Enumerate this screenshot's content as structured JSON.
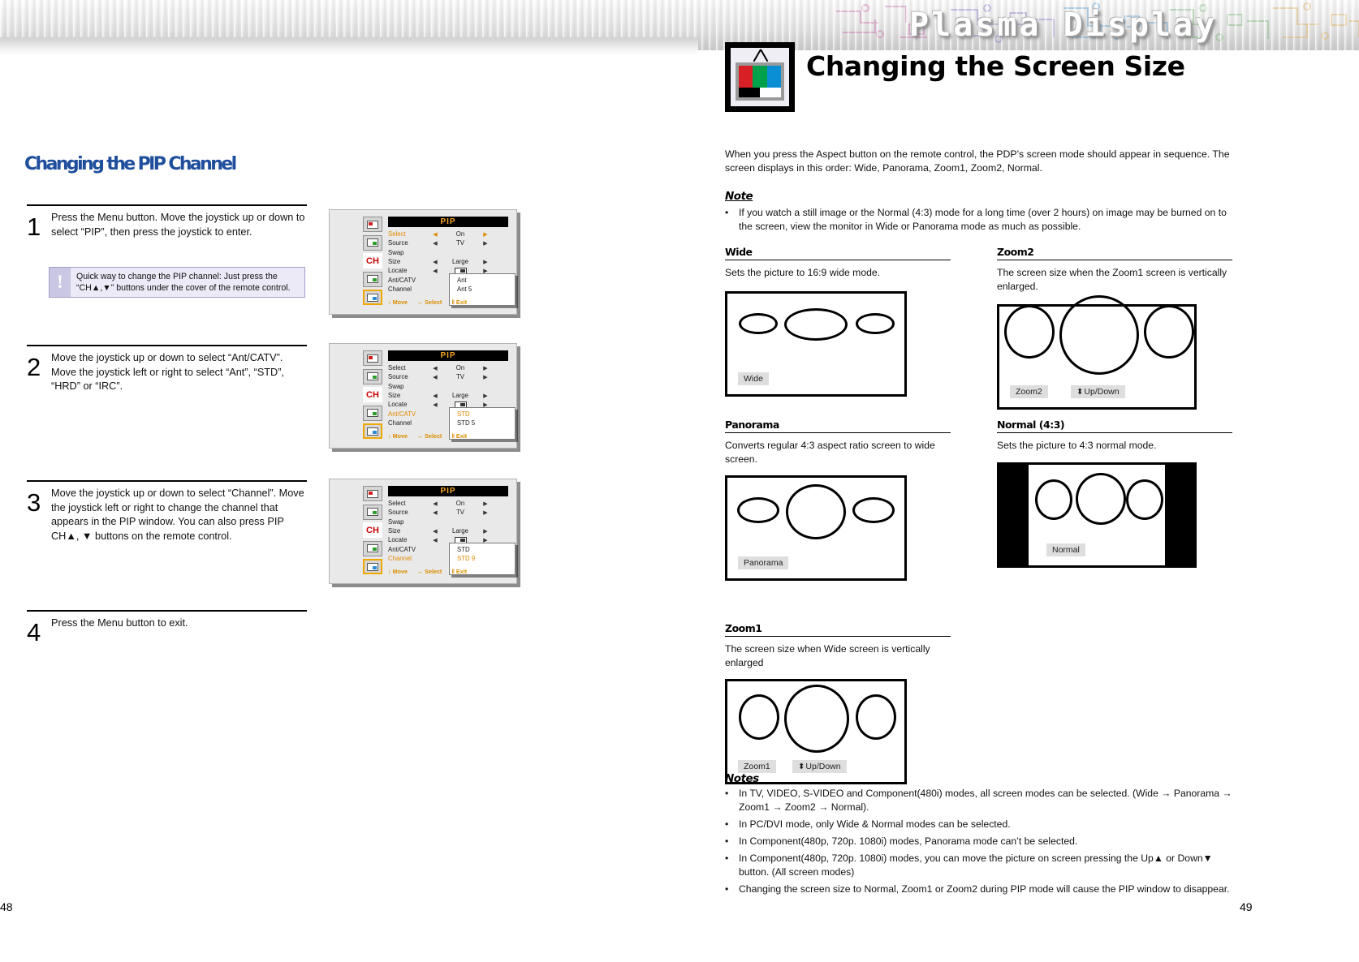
{
  "header": {
    "brand": "Plasma Display",
    "title": "Changing the Screen Size",
    "tv_icon": "tv-icon"
  },
  "left_page": {
    "heading": "Changing the PIP Channel",
    "page_number": "48",
    "steps": [
      {
        "num": "1",
        "text": "Press the Menu button. Move the joystick up or down to select “PIP”, then press the joystick to enter."
      },
      {
        "num": "2",
        "text": "Move the joystick up or down to select “Ant/CATV”. Move the joystick left or right to select “Ant”, “STD”, “HRD” or “IRC”."
      },
      {
        "num": "3",
        "text": "Move the joystick up or down to select “Channel”. Move the joystick left or right to change the channel that appears in the PIP window. You can also press PIP CH▲, ▼ buttons on the remote control."
      },
      {
        "num": "4",
        "text": "Press the Menu button to exit."
      }
    ],
    "tip": {
      "icon": "exclamation-icon",
      "line1": "Quick way to change the PIP channel: Just press the",
      "line2": "“CH▲,▼” buttons under the cover of the remote control."
    },
    "osd_menus": [
      {
        "title": "PIP",
        "highlight": "Select",
        "rows": [
          {
            "label": "Select",
            "value": "On",
            "arrows": true
          },
          {
            "label": "Source",
            "value": "TV",
            "arrows": true
          },
          {
            "label": "Swap",
            "value": "",
            "arrows": false
          },
          {
            "label": "Size",
            "value": "Large",
            "arrows": true
          },
          {
            "label": "Locate",
            "value": "□",
            "arrows": true,
            "isbox": true
          },
          {
            "label": "Ant/CATV",
            "value": "",
            "arrows": false
          },
          {
            "label": "Channel",
            "value": "",
            "arrows": false
          }
        ],
        "popup": {
          "line1": "Ant",
          "line2": "Ant  5",
          "highlight_line": 0
        },
        "bottom": [
          "↕ Move",
          "↔ Select",
          "‖ Exit"
        ]
      },
      {
        "title": "PIP",
        "highlight": "Ant/CATV",
        "rows": [
          {
            "label": "Select",
            "value": "On",
            "arrows": true
          },
          {
            "label": "Source",
            "value": "TV",
            "arrows": true
          },
          {
            "label": "Swap",
            "value": "",
            "arrows": false
          },
          {
            "label": "Size",
            "value": "Large",
            "arrows": true
          },
          {
            "label": "Locate",
            "value": "□",
            "arrows": true,
            "isbox": true
          },
          {
            "label": "Ant/CATV",
            "value": "",
            "arrows": false
          },
          {
            "label": "Channel",
            "value": "",
            "arrows": false
          }
        ],
        "popup": {
          "line1": "STD",
          "line2": "STD  5",
          "highlight_line": 0
        },
        "bottom": [
          "↕ Move",
          "↔ Select",
          "‖ Exit"
        ]
      },
      {
        "title": "PIP",
        "highlight": "Channel",
        "rows": [
          {
            "label": "Select",
            "value": "On",
            "arrows": true
          },
          {
            "label": "Source",
            "value": "TV",
            "arrows": true
          },
          {
            "label": "Swap",
            "value": "",
            "arrows": false
          },
          {
            "label": "Size",
            "value": "Large",
            "arrows": true
          },
          {
            "label": "Locate",
            "value": "□",
            "arrows": true,
            "isbox": true
          },
          {
            "label": "Ant/CATV",
            "value": "",
            "arrows": false
          },
          {
            "label": "Channel",
            "value": "",
            "arrows": false
          }
        ],
        "popup": {
          "line1": "STD",
          "line2": "STD  9",
          "highlight_line": 1
        },
        "bottom": [
          "↕ Move",
          "↔ Select",
          "‖ Exit"
        ]
      }
    ],
    "osd_sidebar_icons": [
      "picture-icon",
      "sound-icon",
      "channel-icon",
      "setup-icon",
      "pip-icon"
    ],
    "osd_ch_label": "CH"
  },
  "right_page": {
    "page_number": "49",
    "intro": "When you press the Aspect button on the remote control, the PDP’s screen mode should appear in sequence. The screen displays in this order: Wide, Panorama, Zoom1, Zoom2, Normal.",
    "note_heading": "Note",
    "note_bullets": [
      "If you watch a still image or the Normal (4:3) mode for a long time (over 2 hours) on image may be burned on to the screen, view the monitor in Wide or Panorama mode as much as possible."
    ],
    "sections": [
      {
        "id": "wide",
        "heading": "Wide",
        "desc": "Sets the picture to 16:9 wide mode.",
        "tags": [
          "Wide"
        ],
        "updown": false
      },
      {
        "id": "zoom2",
        "heading": "Zoom2",
        "desc": "The screen size when the Zoom1 screen is vertically enlarged.",
        "tags": [
          "Zoom2"
        ],
        "updown_label": "Up/Down",
        "updown": true
      },
      {
        "id": "panorama",
        "heading": "Panorama",
        "desc": "Converts regular 4:3 aspect ratio screen to wide screen.",
        "tags": [
          "Panorama"
        ],
        "updown": false
      },
      {
        "id": "normal",
        "heading": "Normal (4:3)",
        "desc": "Sets the picture to 4:3 normal mode.",
        "tags": [
          "Normal"
        ],
        "updown": false
      },
      {
        "id": "zoom1",
        "heading": "Zoom1",
        "desc": "The screen size when Wide screen is vertically enlarged",
        "tags": [
          "Zoom1"
        ],
        "updown_label": "Up/Down",
        "updown": true
      }
    ],
    "notes_heading": "Notes",
    "notes_bullets": [
      "In TV, VIDEO, S-VIDEO and Component(480i) modes, all screen modes can be selected. (Wide → Panorama → Zoom1 → Zoom2 → Normal).",
      "In PC/DVI mode, only Wide & Normal modes can be selected.",
      "In Component(480p, 720p. 1080i) modes, Panorama mode can’t be selected.",
      "In Component(480p, 720p. 1080i) modes, you can move the picture on screen pressing the Up▲ or Down▼ button. (All screen modes)",
      "Changing the screen size to Normal, Zoom1 or Zoom2 during PIP mode will cause the PIP window to disappear."
    ]
  },
  "colors": {
    "heading_blue": "#1f4e9c",
    "osd_orange": "#f5a623",
    "tip_bg": "#eceaf6"
  }
}
